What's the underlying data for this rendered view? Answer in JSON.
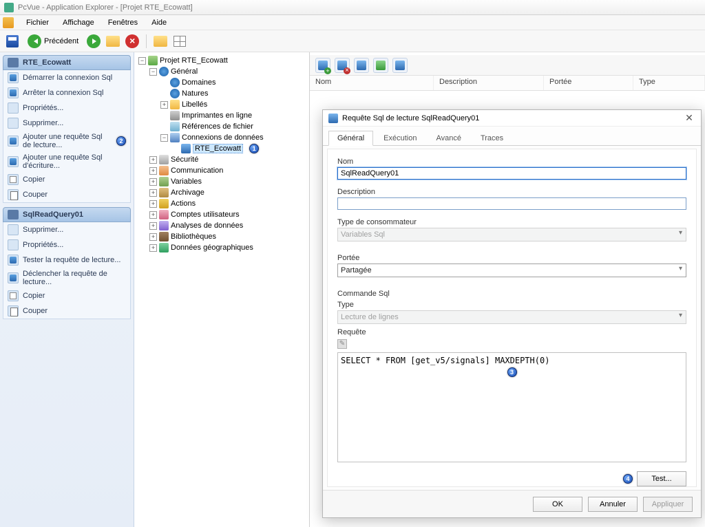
{
  "window": {
    "title": "PcVue - Application Explorer - [Projet RTE_Ecowatt]"
  },
  "menubar": {
    "items": [
      "Fichier",
      "Affichage",
      "Fenêtres",
      "Aide"
    ]
  },
  "toolbar": {
    "precedent": "Précédent"
  },
  "left": {
    "panel1": {
      "title": "RTE_Ecowatt",
      "items": [
        "Démarrer la connexion Sql",
        "Arrêter la connexion Sql",
        "Propriétés...",
        "Supprimer...",
        "Ajouter une requête Sql de lecture...",
        "Ajouter une requête Sql d'écriture...",
        "Copier",
        "Couper"
      ]
    },
    "panel2": {
      "title": "SqlReadQuery01",
      "items": [
        "Supprimer...",
        "Propriétés...",
        "Tester la requête de lecture...",
        "Déclencher la requête de lecture...",
        "Copier",
        "Couper"
      ]
    }
  },
  "tree": {
    "root": "Projet RTE_Ecowatt",
    "general": "Général",
    "general_children": [
      "Domaines",
      "Natures",
      "Libellés",
      "Imprimantes en ligne",
      "Références de fichier",
      "Connexions de données"
    ],
    "conn_child": "RTE_Ecowatt",
    "top_nodes": [
      "Sécurité",
      "Communication",
      "Variables",
      "Archivage",
      "Actions",
      "Comptes utilisateurs",
      "Analyses de données",
      "Bibliothèques",
      "Données géographiques"
    ]
  },
  "grid": {
    "cols": [
      "Nom",
      "Description",
      "Portée",
      "Type"
    ]
  },
  "dialog": {
    "title": "Requête Sql de lecture SqlReadQuery01",
    "tabs": [
      "Général",
      "Exécution",
      "Avancé",
      "Traces"
    ],
    "labels": {
      "nom": "Nom",
      "description": "Description",
      "consommateur": "Type de consommateur",
      "portee": "Portée",
      "commande": "Commande Sql",
      "type": "Type",
      "requete": "Requête"
    },
    "values": {
      "nom": "SqlReadQuery01",
      "description": "",
      "consommateur": "Variables Sql",
      "portee": "Partagée",
      "type": "Lecture de lignes",
      "requete": "SELECT * FROM [get_v5/signals] MAXDEPTH(0)"
    },
    "buttons": {
      "test": "Test...",
      "ok": "OK",
      "annuler": "Annuler",
      "appliquer": "Appliquer"
    }
  },
  "callouts": {
    "c1": "1",
    "c2": "2",
    "c3": "3",
    "c4": "4"
  }
}
